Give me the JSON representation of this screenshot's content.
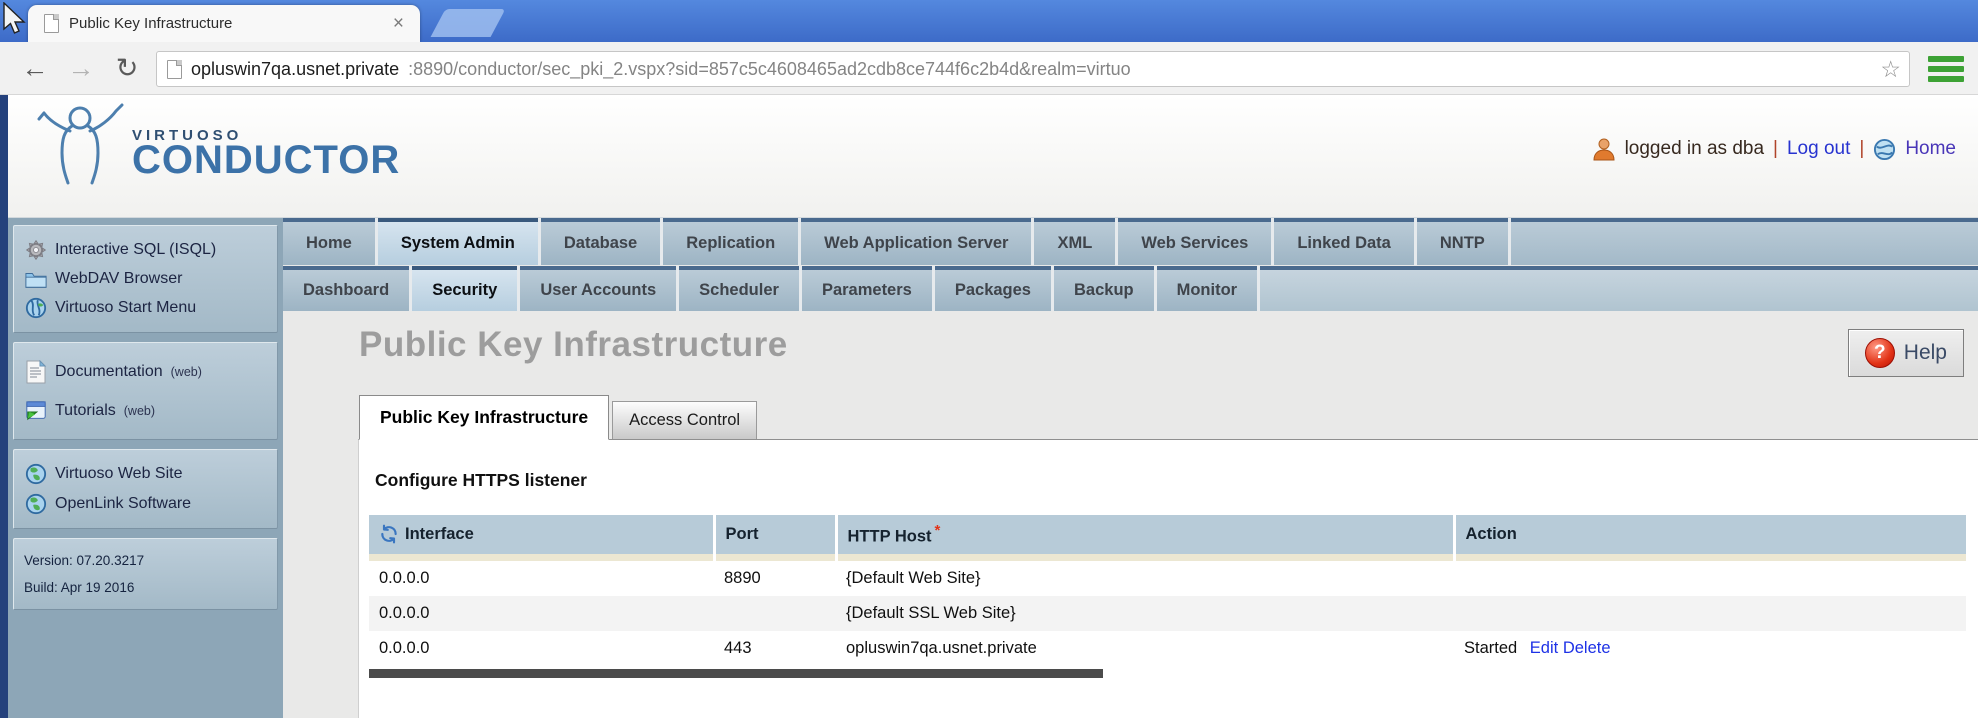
{
  "browser": {
    "tab": {
      "title": "Public Key Infrastructure",
      "close_glyph": "×",
      "favicon": "page-icon"
    },
    "toolbar": {
      "back_glyph": "←",
      "forward_glyph": "→",
      "reload_glyph": "↻",
      "bookmark_star_glyph": "☆",
      "menu_icon": "hamburger-menu-icon"
    },
    "url": {
      "host": "opluswin7qa.usnet.private",
      "rest": ":8890/conductor/sec_pki_2.vspx?sid=857c5c4608465ad2cdb8ce744f6c2b4d&realm=virtuo"
    }
  },
  "header": {
    "brand_small": "VIRTUOSO",
    "brand_large": "CONDUCTOR",
    "user_icon": "person-icon",
    "login_status": "logged in as dba",
    "sep1": "|",
    "logout_label": "Log out",
    "sep2": "|",
    "home_icon": "globe-icon",
    "home_label": "Home"
  },
  "nav_primary": {
    "items": [
      {
        "label": "Home",
        "active": false
      },
      {
        "label": "System Admin",
        "active": true
      },
      {
        "label": "Database",
        "active": false
      },
      {
        "label": "Replication",
        "active": false
      },
      {
        "label": "Web Application Server",
        "active": false
      },
      {
        "label": "XML",
        "active": false
      },
      {
        "label": "Web Services",
        "active": false
      },
      {
        "label": "Linked Data",
        "active": false
      },
      {
        "label": "NNTP",
        "active": false
      }
    ]
  },
  "nav_secondary": {
    "items": [
      {
        "label": "Dashboard",
        "active": false
      },
      {
        "label": "Security",
        "active": true
      },
      {
        "label": "User Accounts",
        "active": false
      },
      {
        "label": "Scheduler",
        "active": false
      },
      {
        "label": "Parameters",
        "active": false
      },
      {
        "label": "Packages",
        "active": false
      },
      {
        "label": "Backup",
        "active": false
      },
      {
        "label": "Monitor",
        "active": false
      }
    ]
  },
  "sidebar": {
    "groups": [
      {
        "items": [
          {
            "icon": "gear-icon",
            "label": "Interactive SQL (ISQL)",
            "suffix": ""
          },
          {
            "icon": "folder-icon",
            "label": "WebDAV Browser",
            "suffix": ""
          },
          {
            "icon": "globe-icon",
            "label": "Virtuoso Start Menu",
            "suffix": ""
          }
        ]
      },
      {
        "items": [
          {
            "icon": "document-icon",
            "label": "Documentation",
            "suffix": "(web)"
          },
          {
            "icon": "tutorial-window-icon",
            "label": "Tutorials",
            "suffix": "(web)"
          }
        ]
      },
      {
        "items": [
          {
            "icon": "globe-icon",
            "label": "Virtuoso Web Site",
            "suffix": ""
          },
          {
            "icon": "globe-icon",
            "label": "OpenLink Software",
            "suffix": ""
          }
        ]
      }
    ],
    "version_line": "Version: 07.20.3217",
    "build_line": "Build: Apr 19 2016"
  },
  "main": {
    "page_title": "Public Key Infrastructure",
    "help": {
      "label": "Help",
      "icon": "help-question-icon",
      "glyph": "?"
    },
    "tabs": [
      {
        "label": "Public Key Infrastructure",
        "active": true
      },
      {
        "label": "Access Control",
        "active": false
      }
    ],
    "section_title": "Configure HTTPS listener",
    "table": {
      "refresh_icon": "refresh-icon",
      "required_mark": "*",
      "columns": [
        "Interface",
        "Port",
        "HTTP Host",
        "Action"
      ],
      "rows": [
        {
          "interface": "0.0.0.0",
          "port": "8890",
          "http_host": "{Default Web Site}",
          "status": "",
          "actions": [
            "",
            ""
          ]
        },
        {
          "interface": "0.0.0.0",
          "port": "",
          "http_host": "{Default SSL Web Site}",
          "status": "",
          "actions": [
            "",
            ""
          ]
        },
        {
          "interface": "0.0.0.0",
          "port": "443",
          "http_host": "opluswin7qa.usnet.private",
          "status": "Started",
          "actions": [
            "Edit",
            "Delete"
          ]
        }
      ]
    }
  },
  "colors": {
    "titlebar_blue": "#4377d9",
    "brand_blue": "#3c72a8",
    "nav_tab_top": "#4a6a8e",
    "table_header_bg": "#b7cbd8",
    "link_blue": "#1e32e6",
    "help_red": "#d42010",
    "menu_green": "#3da235",
    "sidebar_bg": "#8da6b7"
  }
}
